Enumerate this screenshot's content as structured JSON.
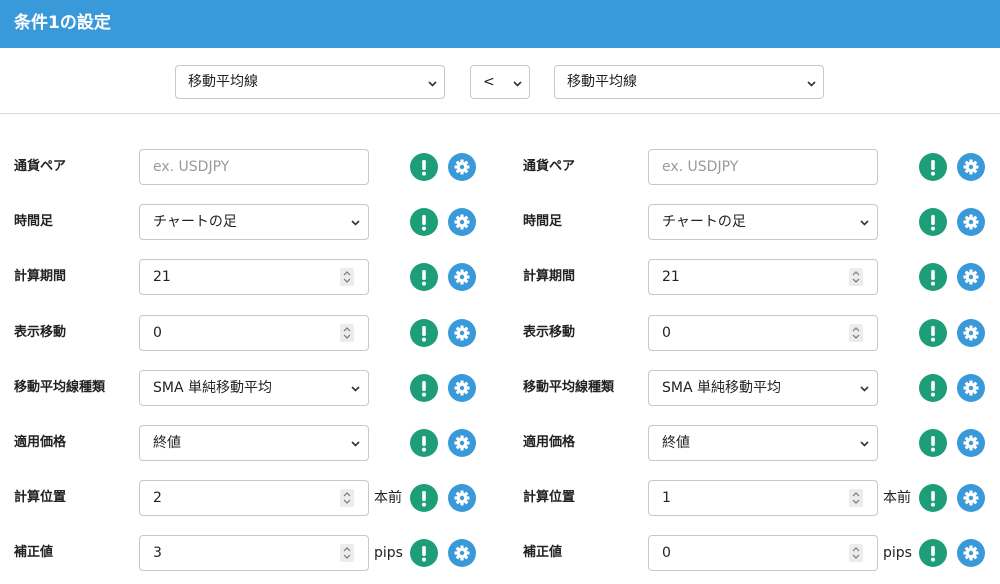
{
  "header": {
    "title": "条件1の設定"
  },
  "condition": {
    "left_indicator": "移動平均線",
    "operator": "<",
    "right_indicator": "移動平均線"
  },
  "columns": [
    {
      "rows": [
        {
          "label": "通貨ペア",
          "type": "input",
          "value": "",
          "placeholder": "ex. USDJPY",
          "unit": ""
        },
        {
          "label": "時間足",
          "type": "select",
          "value": "チャートの足",
          "unit": ""
        },
        {
          "label": "計算期間",
          "type": "number",
          "value": "21",
          "unit": ""
        },
        {
          "label": "表示移動",
          "type": "number",
          "value": "0",
          "unit": ""
        },
        {
          "label": "移動平均線種類",
          "type": "select",
          "value": "SMA 単純移動平均",
          "unit": ""
        },
        {
          "label": "適用価格",
          "type": "select",
          "value": "終値",
          "unit": ""
        },
        {
          "label": "計算位置",
          "type": "number",
          "value": "2",
          "unit": "本前"
        },
        {
          "label": "補正値",
          "type": "number",
          "value": "3",
          "unit": "pips"
        }
      ]
    },
    {
      "rows": [
        {
          "label": "通貨ペア",
          "type": "input",
          "value": "",
          "placeholder": "ex. USDJPY",
          "unit": ""
        },
        {
          "label": "時間足",
          "type": "select",
          "value": "チャートの足",
          "unit": ""
        },
        {
          "label": "計算期間",
          "type": "number",
          "value": "21",
          "unit": ""
        },
        {
          "label": "表示移動",
          "type": "number",
          "value": "0",
          "unit": ""
        },
        {
          "label": "移動平均線種類",
          "type": "select",
          "value": "SMA 単純移動平均",
          "unit": ""
        },
        {
          "label": "適用価格",
          "type": "select",
          "value": "終値",
          "unit": ""
        },
        {
          "label": "計算位置",
          "type": "number",
          "value": "1",
          "unit": "本前"
        },
        {
          "label": "補正値",
          "type": "number",
          "value": "0",
          "unit": "pips"
        }
      ]
    }
  ],
  "icons": {
    "info": "exclamation-icon",
    "settings": "gear-icon"
  },
  "colors": {
    "header": "#3a9ad9",
    "info_button": "#1e9e78",
    "settings_button": "#3a9ad9"
  }
}
